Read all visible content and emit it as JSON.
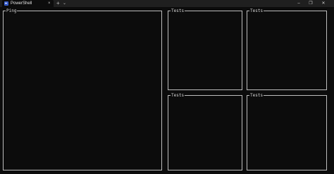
{
  "window": {
    "tab_title": "PowerShell",
    "tab_close": "×",
    "new_tab": "+",
    "dropdown": "⌄",
    "minimize": "–",
    "maximize": "❐",
    "close": "✕"
  },
  "panels": [
    {
      "title": "Ping"
    },
    {
      "title": "Tests"
    },
    {
      "title": "Tests"
    },
    {
      "title": "Tests"
    },
    {
      "title": "Tests"
    }
  ]
}
